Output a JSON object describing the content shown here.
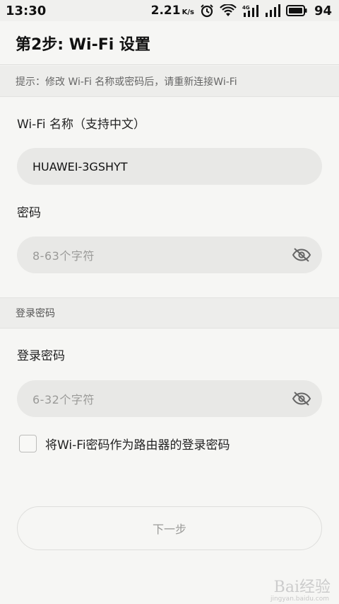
{
  "status_bar": {
    "time": "13:30",
    "speed": "2.21",
    "speed_unit": "K/s",
    "network": "4G",
    "battery": "94"
  },
  "title": "第2步: Wi-Fi 设置",
  "hint": "提示：修改 Wi-Fi 名称或密码后，请重新连接Wi-Fi",
  "wifi": {
    "name_label": "Wi-Fi 名称（支持中文）",
    "name_value": "HUAWEI-3GSHYT",
    "password_label": "密码",
    "password_placeholder": "8-63个字符"
  },
  "login": {
    "section_title": "登录密码",
    "password_label": "登录密码",
    "password_placeholder": "6-32个字符",
    "checkbox_label": "将Wi-Fi密码作为路由器的登录密码"
  },
  "next_button": "下一步",
  "watermark": {
    "text": "Bai经验",
    "sub": "jingyan.baidu.com"
  }
}
